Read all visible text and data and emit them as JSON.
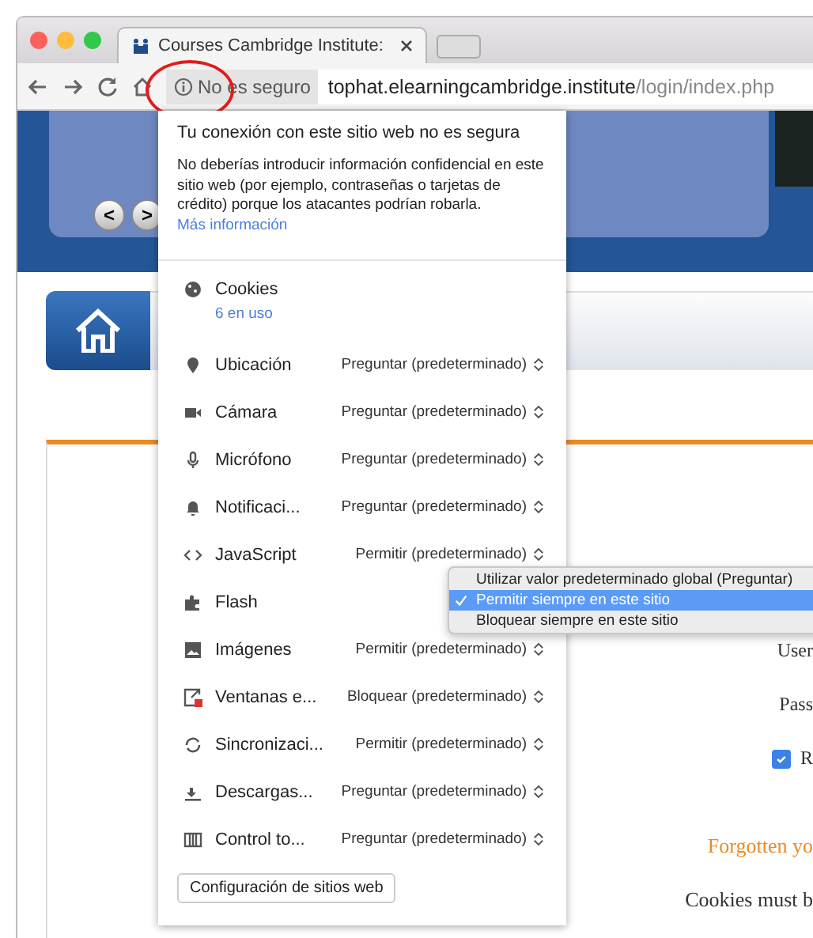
{
  "browser": {
    "tab": {
      "title": "Courses Cambridge Institute:"
    },
    "address_bar": {
      "security_label": "No es seguro",
      "host": "tophat.elearningcambridge.institute",
      "path": "/login/index.php"
    }
  },
  "page": {
    "slider_buttons": [
      "<",
      ">"
    ],
    "login_labels": [
      "User",
      "Pass"
    ],
    "remember_checkbox": {
      "label": "R",
      "checked": true
    },
    "forgot_link": "Forgotten yo",
    "cookies_note": "Cookies must b"
  },
  "site_info_popup": {
    "title": "Tu conexión con este sitio web no es segura",
    "warning": "No deberías introducir información confidencial en este sitio web (por ejemplo, contraseñas o tarjetas de crédito) porque los atacantes podrían robarla.",
    "more_info_link": "Más información",
    "permissions": [
      {
        "kind": "cookies",
        "label": "Cookies",
        "detail": "6 en uso"
      },
      {
        "kind": "select",
        "label": "Ubicación",
        "value": "Preguntar (predeterminado)"
      },
      {
        "kind": "select",
        "label": "Cámara",
        "value": "Preguntar (predeterminado)"
      },
      {
        "kind": "select",
        "label": "Micrófono",
        "value": "Preguntar (predeterminado)"
      },
      {
        "kind": "select",
        "label": "Notificaci...",
        "value": "Preguntar (predeterminado)"
      },
      {
        "kind": "select",
        "label": "JavaScript",
        "value": "Permitir (predeterminado)"
      },
      {
        "kind": "select",
        "label": "Flash"
      },
      {
        "kind": "select",
        "label": "Imágenes",
        "value": "Permitir (predeterminado)"
      },
      {
        "kind": "select",
        "label": "Ventanas e...",
        "value": "Bloquear (predeterminado)"
      },
      {
        "kind": "select",
        "label": "Sincronizaci...",
        "value": "Permitir (predeterminado)"
      },
      {
        "kind": "select",
        "label": "Descargas...",
        "value": "Preguntar (predeterminado)"
      },
      {
        "kind": "select",
        "label": "Control to...",
        "value": "Preguntar (predeterminado)"
      }
    ],
    "site_settings_button": "Configuración de sitios web"
  },
  "dropdown_menu": {
    "options": [
      {
        "label": "Utilizar valor predeterminado global (Preguntar)",
        "selected": false
      },
      {
        "label": "Permitir siempre en este sitio",
        "selected": true
      },
      {
        "label": "Bloquear siempre en este sitio",
        "selected": false
      }
    ]
  }
}
